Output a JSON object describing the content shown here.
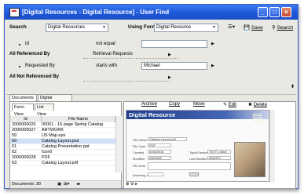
{
  "window": {
    "title": "[Digital Resources - Digital Resource] - User Find"
  },
  "search": {
    "label": "Search",
    "object": "Digital Resources",
    "using_label": "Using Form",
    "using_value": "Digital Resource",
    "save_label": "Save",
    "search_label": "Search"
  },
  "criteria": {
    "row1": {
      "field": "Id",
      "operator": "not equal",
      "value": ""
    },
    "group1": {
      "label": "All Referenced By",
      "value": "Retrieval Requests"
    },
    "row2": {
      "field": "Requested By",
      "operator": "starts with",
      "value": "Michael"
    },
    "group2": {
      "label": "All Not Referenced By",
      "value": ""
    }
  },
  "tabs": [
    "Documents",
    "Digital Resources"
  ],
  "view_tabs": [
    "Form View",
    "List View"
  ],
  "grid": {
    "headers": [
      "Id",
      "File Name"
    ],
    "rows": [
      [
        "2000000026",
        "00001 - 16 page Spring Catalog"
      ],
      [
        "2000000027",
        "ARTWORK"
      ],
      [
        "59",
        "US Map.eps"
      ],
      [
        "60",
        "Catalog Layout.psd"
      ],
      [
        "61",
        "Catalog Presentation.ppt"
      ],
      [
        "62",
        "Iconll"
      ],
      [
        "2000000028",
        "PDF"
      ],
      [
        "63",
        "Catalog Layout.pdf"
      ]
    ],
    "footer": "Documents: 30"
  },
  "actions": [
    "Archive",
    "Copy",
    "Move",
    "Edit",
    "Delete"
  ],
  "preview": {
    "header": "Digital Resource",
    "fields": [
      {
        "label": "File Name",
        "value": "Catalog Layout.pdf"
      },
      {
        "label": "File Type",
        "value": "PDF"
      },
      {
        "label": "Created",
        "value": "6/26/2008"
      },
      {
        "label": "Modified",
        "value": "6/6/2008"
      },
      {
        "label": "File Note",
        "value": ""
      },
      {
        "label": "Archiving Id",
        "value": ""
      }
    ],
    "type_creator_label": "Type/Creator",
    "type_creator_value": "TEXT LINAS",
    "last_modified_label": "Last Modified",
    "last_modified_value": "6/6/2007"
  },
  "colors": {
    "title_bar": "#1d57d9",
    "preview_header": "#1f3f8c",
    "selected_row": "#cfe0f8"
  }
}
